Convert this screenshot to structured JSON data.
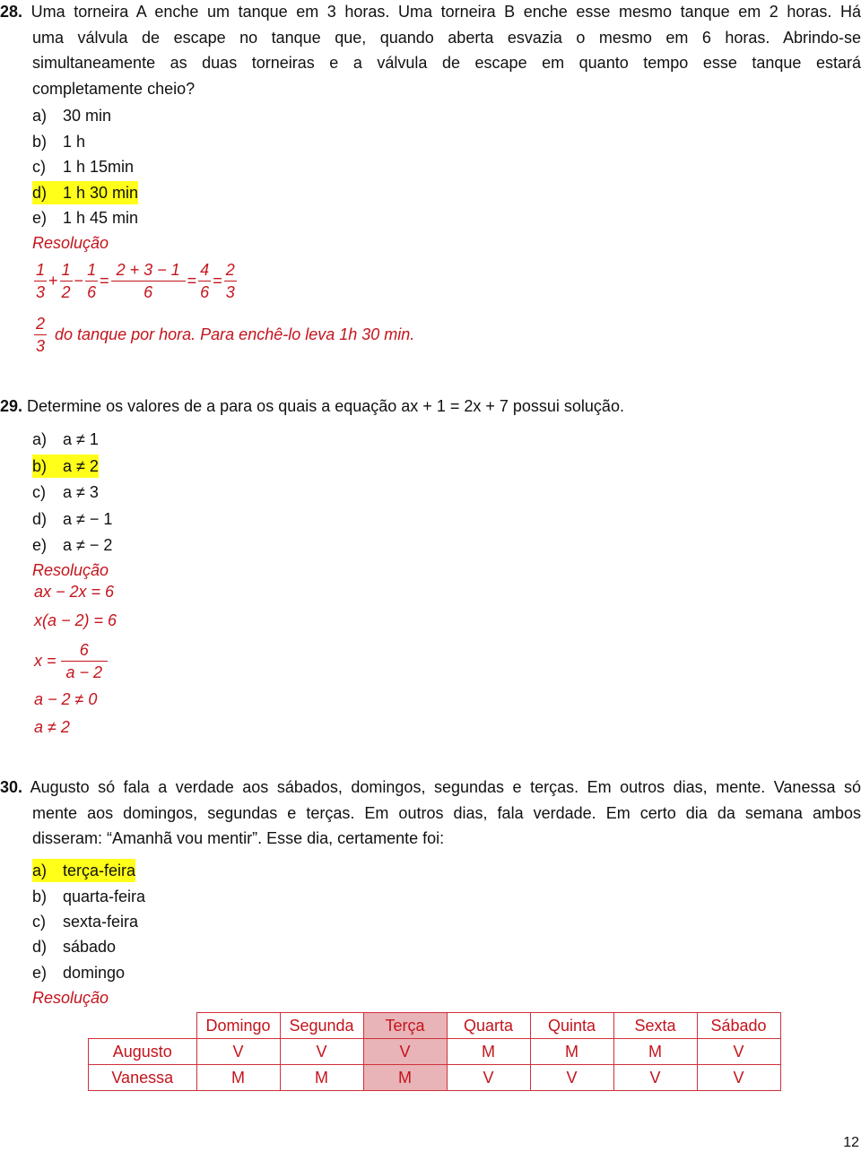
{
  "q28": {
    "number": "28.",
    "lines": [
      "Uma torneira A enche um tanque em 3 horas. Uma torneira B enche esse mesmo tanque em 2 horas. Há",
      "uma válvula de escape no tanque que, quando aberta esvazia o mesmo em 6 horas. Abrindo-se",
      "simultaneamente as duas torneiras e a válvula de escape em quanto tempo esse tanque estará",
      "completamente cheio?"
    ],
    "options": [
      {
        "label": "a)",
        "text": "30 min",
        "highlighted": false
      },
      {
        "label": "b)",
        "text": "1 h",
        "highlighted": false
      },
      {
        "label": "c)",
        "text": "1 h 15min",
        "highlighted": false
      },
      {
        "label": "d)",
        "text": "1 h 30 min",
        "highlighted": true
      },
      {
        "label": "e)",
        "text": "1 h 45 min",
        "highlighted": false
      }
    ],
    "resolution_title": "Resolução",
    "equation": {
      "f1n": "1",
      "f1d": "3",
      "op1": "+",
      "f2n": "1",
      "f2d": "2",
      "op2": "−",
      "f3n": "1",
      "f3d": "6",
      "eq1": "=",
      "f4n": "2 + 3 − 1",
      "f4d": "6",
      "eq2": "=",
      "f5n": "4",
      "f5d": "6",
      "eq3": "=",
      "f6n": "2",
      "f6d": "3"
    },
    "conclusion": {
      "fn": "2",
      "fd": "3",
      "text": "do tanque por hora. Para enchê-lo leva 1h 30 min."
    }
  },
  "q29": {
    "number": "29.",
    "text": "Determine os valores de a para os quais a equação ax + 1 = 2x + 7 possui solução.",
    "options": [
      {
        "label": "a)",
        "text": "a ≠ 1",
        "highlighted": false
      },
      {
        "label": "b)",
        "text": "a ≠ 2",
        "highlighted": true
      },
      {
        "label": "c)",
        "text": "a ≠ 3",
        "highlighted": false
      },
      {
        "label": "d)",
        "text": "a ≠ − 1",
        "highlighted": false
      },
      {
        "label": "e)",
        "text": "a ≠ − 2",
        "highlighted": false
      }
    ],
    "resolution_title": "Resolução",
    "steps": {
      "s1": "ax − 2x = 6",
      "s2": "x(a − 2) = 6",
      "s3_lhs": "x =",
      "s3_n": "6",
      "s3_d": "a − 2",
      "s4": "a − 2 ≠ 0",
      "s5": "a ≠ 2"
    }
  },
  "q30": {
    "number": "30.",
    "lines": [
      "Augusto só fala a verdade aos sábados, domingos, segundas e terças. Em outros dias, mente. Vanessa só",
      "mente aos domingos, segundas e terças. Em outros dias, fala verdade. Em certo dia da semana ambos",
      "disseram: “Amanhã vou mentir”. Esse dia, certamente foi:"
    ],
    "options": [
      {
        "label": "a)",
        "text": "terça-feira",
        "highlighted": true
      },
      {
        "label": "b)",
        "text": "quarta-feira",
        "highlighted": false
      },
      {
        "label": "c)",
        "text": "sexta-feira",
        "highlighted": false
      },
      {
        "label": "d)",
        "text": "sábado",
        "highlighted": false
      },
      {
        "label": "e)",
        "text": "domingo",
        "highlighted": false
      }
    ],
    "resolution_title": "Resolução",
    "table": {
      "headers": [
        "Domingo",
        "Segunda",
        "Terça",
        "Quarta",
        "Quinta",
        "Sexta",
        "Sábado"
      ],
      "highlighted_column": "Terça",
      "rows": [
        {
          "name": "Augusto",
          "values": [
            "V",
            "V",
            "V",
            "M",
            "M",
            "M",
            "V"
          ]
        },
        {
          "name": "Vanessa",
          "values": [
            "M",
            "M",
            "M",
            "V",
            "V",
            "V",
            "V"
          ]
        }
      ]
    }
  },
  "colors": {
    "resolution": "#c4141c",
    "highlight": "#ffff1a",
    "table_shade": "#e8b4b8"
  },
  "page_number": "12"
}
